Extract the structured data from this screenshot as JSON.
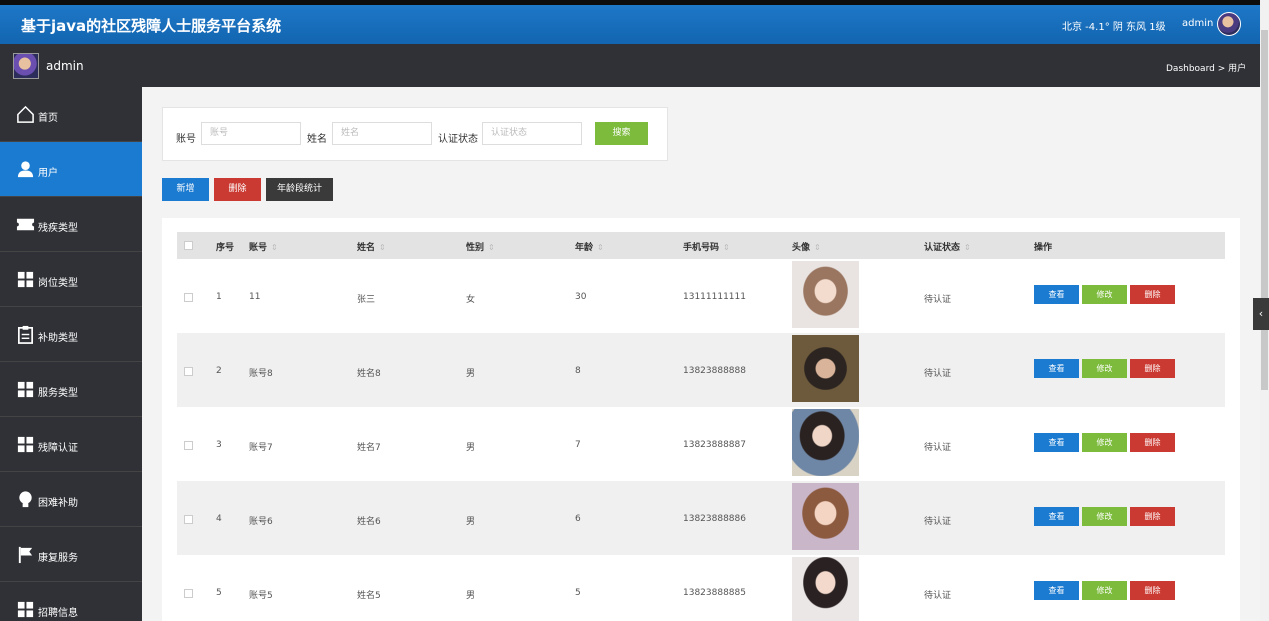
{
  "header": {
    "title": "基于java的社区残障人士服务平台系统",
    "weather": "北京 -4.1° 阴 东风 1级",
    "user": "admin"
  },
  "subheader": {
    "username": "admin",
    "breadcrumb": "Dashboard > 用户"
  },
  "sidebar": {
    "items": [
      {
        "label": "首页",
        "icon": "home-icon"
      },
      {
        "label": "用户",
        "icon": "user-icon"
      },
      {
        "label": "残疾类型",
        "icon": "ticket-icon"
      },
      {
        "label": "岗位类型",
        "icon": "grid-icon"
      },
      {
        "label": "补助类型",
        "icon": "clipboard-icon"
      },
      {
        "label": "服务类型",
        "icon": "grid-icon"
      },
      {
        "label": "残障认证",
        "icon": "grid-icon"
      },
      {
        "label": "困难补助",
        "icon": "bulb-icon"
      },
      {
        "label": "康复服务",
        "icon": "flag-icon"
      },
      {
        "label": "招聘信息",
        "icon": "grid-icon"
      }
    ]
  },
  "search": {
    "account_label": "账号",
    "account_placeholder": "账号",
    "name_label": "姓名",
    "name_placeholder": "姓名",
    "status_label": "认证状态",
    "status_placeholder": "认证状态",
    "search_button": "搜索"
  },
  "actions": {
    "add": "新增",
    "delete": "删除",
    "age_stats": "年龄段统计"
  },
  "table": {
    "headers": [
      "序号",
      "账号",
      "姓名",
      "性别",
      "年龄",
      "手机号码",
      "头像",
      "认证状态",
      "操作"
    ],
    "view_label": "查看",
    "edit_label": "修改",
    "delete_label": "删除",
    "rows": [
      {
        "no": "1",
        "account": "11",
        "name": "张三",
        "gender": "女",
        "age": "30",
        "phone": "13111111111",
        "status": "待认证"
      },
      {
        "no": "2",
        "account": "账号8",
        "name": "姓名8",
        "gender": "男",
        "age": "8",
        "phone": "13823888888",
        "status": "待认证"
      },
      {
        "no": "3",
        "account": "账号7",
        "name": "姓名7",
        "gender": "男",
        "age": "7",
        "phone": "13823888887",
        "status": "待认证"
      },
      {
        "no": "4",
        "account": "账号6",
        "name": "姓名6",
        "gender": "男",
        "age": "6",
        "phone": "13823888886",
        "status": "待认证"
      },
      {
        "no": "5",
        "account": "账号5",
        "name": "姓名5",
        "gender": "男",
        "age": "5",
        "phone": "13823888885",
        "status": "待认证"
      }
    ]
  },
  "colors": {
    "primary": "#1b7bd0",
    "success": "#7cbb3c",
    "danger": "#cb3a32",
    "dark": "#2f3136"
  }
}
